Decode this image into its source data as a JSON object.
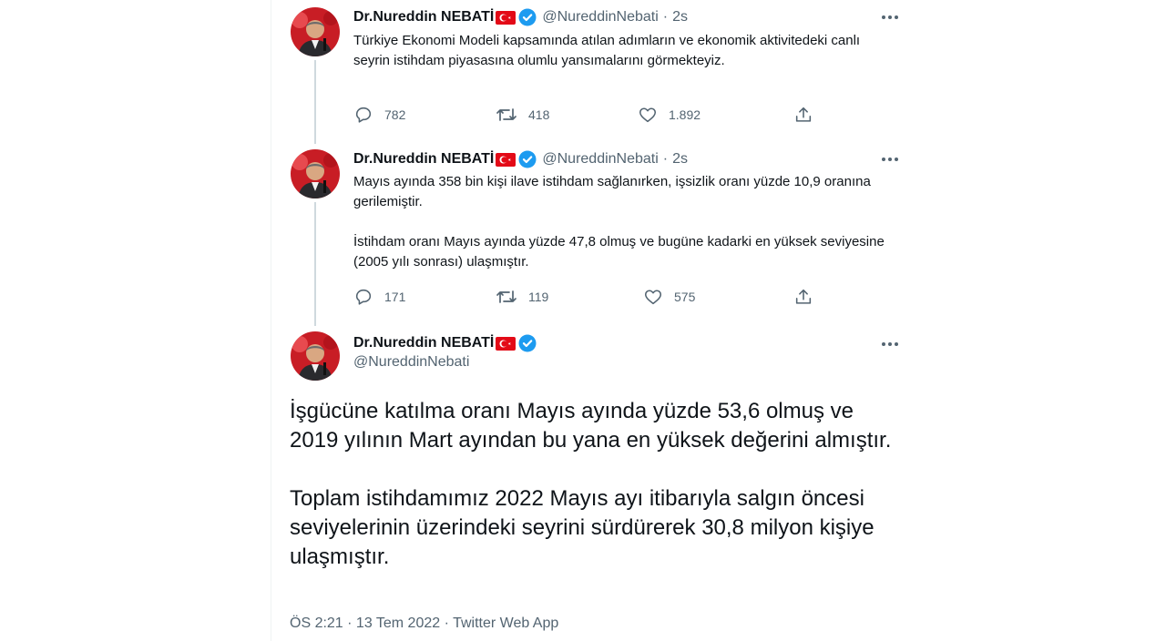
{
  "author": {
    "name": "Dr.Nureddin NEBATİ",
    "handle": "@NureddinNebati"
  },
  "separator": "·",
  "tweets": [
    {
      "time": "2s",
      "paragraphs": [
        "Türkiye Ekonomi Modeli kapsamında atılan adımların ve ekonomik aktivitedeki canlı seyrin istihdam piyasasına olumlu yansımalarını görmekteyiz."
      ],
      "replies": "782",
      "retweets": "418",
      "likes": "1.892"
    },
    {
      "time": "2s",
      "paragraphs": [
        "Mayıs ayında 358 bin kişi ilave istihdam sağlanırken, işsizlik oranı yüzde 10,9 oranına gerilemiştir.",
        "İstihdam oranı Mayıs ayında yüzde 47,8 olmuş ve bugüne kadarki en yüksek seviyesine (2005 yılı sonrası) ulaşmıştır."
      ],
      "replies": "171",
      "retweets": "119",
      "likes": "575"
    }
  ],
  "main_tweet": {
    "paragraphs": [
      "İşgücüne katılma oranı Mayıs ayında yüzde 53,6 olmuş ve 2019 yılının Mart ayından bu yana en yüksek değerini almıştır.",
      "Toplam istihdamımız 2022 Mayıs ayı itibarıyla salgın öncesi seviyelerinin üzerindeki seyrini sürdürerek 30,8 milyon kişiye ulaşmıştır."
    ],
    "meta": "ÖS 2:21 · 13 Tem 2022 · Twitter Web App"
  },
  "icons": {
    "verified": "verified-badge-icon",
    "flag": "turkey-flag-icon",
    "more": "more-dots-icon",
    "reply": "reply-icon",
    "retweet": "retweet-icon",
    "like": "heart-icon",
    "share": "share-icon"
  },
  "colors": {
    "verified_blue": "#1d9bf0",
    "text_primary": "#0f1419",
    "text_secondary": "#536471",
    "flag_red": "#e30a17",
    "thread_line": "#cfd9de"
  }
}
